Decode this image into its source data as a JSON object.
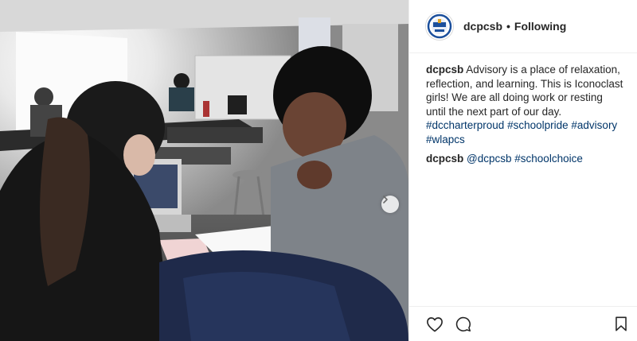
{
  "header": {
    "username": "dcpcsb",
    "separator": "•",
    "follow_status": "Following",
    "avatar_icon": "dcpcsb-logo-icon"
  },
  "caption": {
    "username": "dcpcsb",
    "text": "Advisory is a place of relaxation, reflection, and learning. This is Iconoclast girls! We are all doing work or resting until the next part of our day.",
    "hashtags": [
      "#dccharterproud",
      "#schoolpride",
      "#advisory",
      "#wlapcs"
    ]
  },
  "comments": [
    {
      "username": "dcpcsb",
      "mention": "@dcpcsb",
      "hashtag": "#schoolchoice"
    }
  ],
  "actions": {
    "like_icon": "heart-icon",
    "comment_icon": "comment-bubble-icon",
    "save_icon": "bookmark-icon"
  },
  "media": {
    "next_icon": "chevron-right-icon"
  },
  "colors": {
    "text": "#262626",
    "hashtag": "#003569",
    "border": "#efefef",
    "avatar_ring": "#1b4f9c"
  }
}
